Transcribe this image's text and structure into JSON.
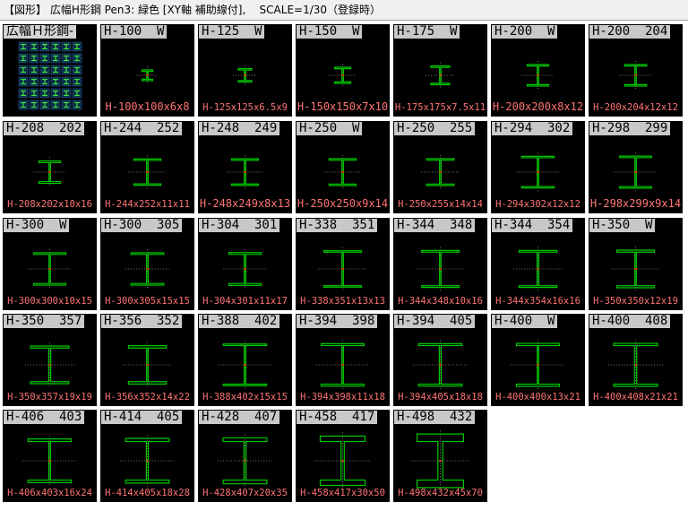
{
  "titlebar": {
    "text": "【図形】 広幅H形鋼 Pen3: 緑色 [XY軸 補助線付],    SCALE=1/30（登録時）"
  },
  "colors": {
    "tile_bg": "#000000",
    "section_outline": "#00c800",
    "axis_line": "#7a7a7a",
    "center_mark": "#ff2020",
    "dim_text": "#ff7373",
    "label_bg": "#c8c8c8"
  },
  "tiles": [
    {
      "label": "広幅Ｈ形鋼-",
      "dim": "",
      "type": "preview"
    },
    {
      "label": "H-100  W",
      "dim": "H-100x100x6x8",
      "H": 100,
      "B": 100,
      "tw": 6,
      "tf": 8,
      "selected": true
    },
    {
      "label": "H-125  W",
      "dim": "H-125x125x6.5x9",
      "H": 125,
      "B": 125,
      "tw": 6.5,
      "tf": 9
    },
    {
      "label": "H-150  W",
      "dim": "H-150x150x7x10",
      "H": 150,
      "B": 150,
      "tw": 7,
      "tf": 10
    },
    {
      "label": "H-175  W",
      "dim": "H-175x175x7.5x11",
      "H": 175,
      "B": 175,
      "tw": 7.5,
      "tf": 11
    },
    {
      "label": "H-200  W",
      "dim": "H-200x200x8x12",
      "H": 200,
      "B": 200,
      "tw": 8,
      "tf": 12
    },
    {
      "label": "H-200  204",
      "dim": "H-200x204x12x12",
      "H": 200,
      "B": 204,
      "tw": 12,
      "tf": 12
    },
    {
      "label": "H-208  202",
      "dim": "H-208x202x10x16",
      "H": 208,
      "B": 202,
      "tw": 10,
      "tf": 16
    },
    {
      "label": "H-244  252",
      "dim": "H-244x252x11x11",
      "H": 244,
      "B": 252,
      "tw": 11,
      "tf": 11
    },
    {
      "label": "H-248  249",
      "dim": "H-248x249x8x13",
      "H": 248,
      "B": 249,
      "tw": 8,
      "tf": 13
    },
    {
      "label": "H-250  W",
      "dim": "H-250x250x9x14",
      "H": 250,
      "B": 250,
      "tw": 9,
      "tf": 14
    },
    {
      "label": "H-250  255",
      "dim": "H-250x255x14x14",
      "H": 250,
      "B": 255,
      "tw": 14,
      "tf": 14
    },
    {
      "label": "H-294  302",
      "dim": "H-294x302x12x12",
      "H": 294,
      "B": 302,
      "tw": 12,
      "tf": 12
    },
    {
      "label": "H-298  299",
      "dim": "H-298x299x9x14",
      "H": 298,
      "B": 299,
      "tw": 9,
      "tf": 14
    },
    {
      "label": "H-300  W",
      "dim": "H-300x300x10x15",
      "H": 300,
      "B": 300,
      "tw": 10,
      "tf": 15
    },
    {
      "label": "H-300  305",
      "dim": "H-300x305x15x15",
      "H": 300,
      "B": 305,
      "tw": 15,
      "tf": 15
    },
    {
      "label": "H-304  301",
      "dim": "H-304x301x11x17",
      "H": 304,
      "B": 301,
      "tw": 11,
      "tf": 17
    },
    {
      "label": "H-338  351",
      "dim": "H-338x351x13x13",
      "H": 338,
      "B": 351,
      "tw": 13,
      "tf": 13
    },
    {
      "label": "H-344  348",
      "dim": "H-344x348x10x16",
      "H": 344,
      "B": 348,
      "tw": 10,
      "tf": 16
    },
    {
      "label": "H-344  354",
      "dim": "H-344x354x16x16",
      "H": 344,
      "B": 354,
      "tw": 16,
      "tf": 16
    },
    {
      "label": "H-350  W",
      "dim": "H-350x350x12x19",
      "H": 350,
      "B": 350,
      "tw": 12,
      "tf": 19
    },
    {
      "label": "H-350  357",
      "dim": "H-350x357x19x19",
      "H": 350,
      "B": 357,
      "tw": 19,
      "tf": 19
    },
    {
      "label": "H-356  352",
      "dim": "H-356x352x14x22",
      "H": 356,
      "B": 352,
      "tw": 14,
      "tf": 22
    },
    {
      "label": "H-388  402",
      "dim": "H-388x402x15x15",
      "H": 388,
      "B": 402,
      "tw": 15,
      "tf": 15
    },
    {
      "label": "H-394  398",
      "dim": "H-394x398x11x18",
      "H": 394,
      "B": 398,
      "tw": 11,
      "tf": 18
    },
    {
      "label": "H-394  405",
      "dim": "H-394x405x18x18",
      "H": 394,
      "B": 405,
      "tw": 18,
      "tf": 18
    },
    {
      "label": "H-400  W",
      "dim": "H-400x400x13x21",
      "H": 400,
      "B": 400,
      "tw": 13,
      "tf": 21
    },
    {
      "label": "H-400  408",
      "dim": "H-400x408x21x21",
      "H": 400,
      "B": 408,
      "tw": 21,
      "tf": 21
    },
    {
      "label": "H-406  403",
      "dim": "H-406x403x16x24",
      "H": 406,
      "B": 403,
      "tw": 16,
      "tf": 24
    },
    {
      "label": "H-414  405",
      "dim": "H-414x405x18x28",
      "H": 414,
      "B": 405,
      "tw": 18,
      "tf": 28
    },
    {
      "label": "H-428  407",
      "dim": "H-428x407x20x35",
      "H": 428,
      "B": 407,
      "tw": 20,
      "tf": 35
    },
    {
      "label": "H-458  417",
      "dim": "H-458x417x30x50",
      "H": 458,
      "B": 417,
      "tw": 30,
      "tf": 50
    },
    {
      "label": "H-498  432",
      "dim": "H-498x432x45x70",
      "H": 498,
      "B": 432,
      "tw": 45,
      "tf": 70
    }
  ]
}
